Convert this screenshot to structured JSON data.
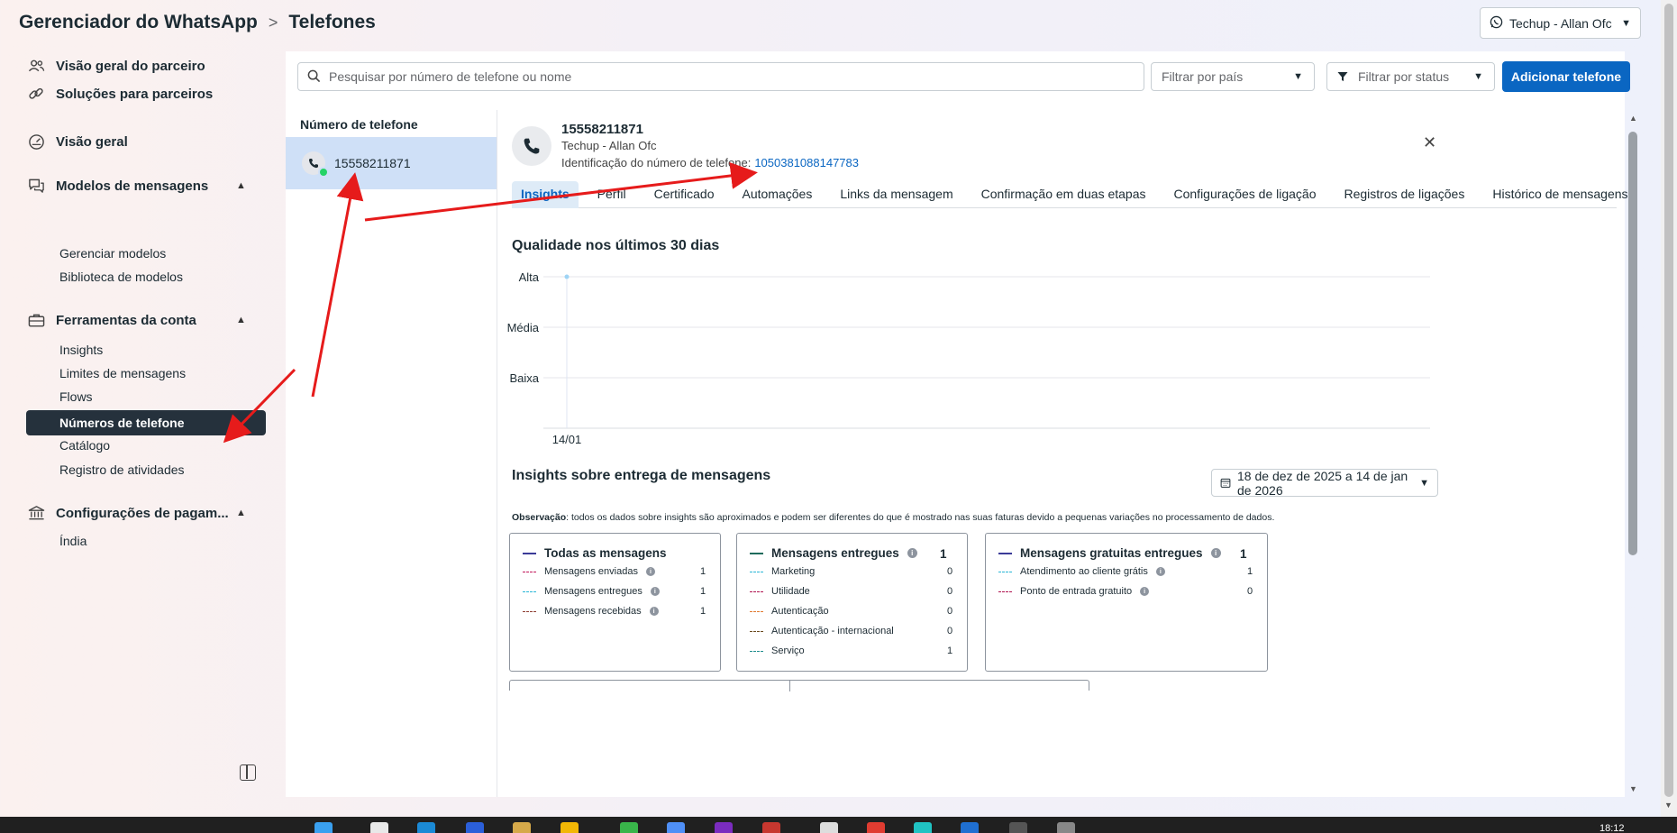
{
  "header": {
    "app_title": "Gerenciador do WhatsApp",
    "separator": ">",
    "page_title": "Telefones",
    "account_label": "Techup - Allan Ofc"
  },
  "sidebar": {
    "partner_overview": "Visão geral do parceiro",
    "partner_solutions": "Soluções para parceiros",
    "overview": "Visão geral",
    "message_templates": {
      "label": "Modelos de mensagens",
      "items": [
        "Gerenciar modelos",
        "Biblioteca de modelos"
      ]
    },
    "account_tools": {
      "label": "Ferramentas da conta",
      "items": [
        "Insights",
        "Limites de mensagens",
        "Flows",
        "Números de telefone",
        "Catálogo",
        "Registro de atividades"
      ],
      "active": "Números de telefone"
    },
    "payment_settings": {
      "label": "Configurações de pagam...",
      "items": [
        "Índia"
      ]
    }
  },
  "toolbar": {
    "search_placeholder": "Pesquisar por número de telefone ou nome",
    "filter_country": "Filtrar por país",
    "filter_status": "Filtrar por status",
    "add_button": "Adicionar telefone"
  },
  "phone_list": {
    "header": "Número de telefone",
    "items": [
      "15558211871"
    ]
  },
  "detail": {
    "number": "15558211871",
    "name": "Techup - Allan Ofc",
    "id_label": "Identificação do número de telefone:",
    "id_value": "1050381088147783",
    "tabs": [
      "Insights",
      "Perfil",
      "Certificado",
      "Automações",
      "Links da mensagem",
      "Confirmação em duas etapas",
      "Configurações de ligação",
      "Registros de ligações",
      "Histórico de mensagens"
    ],
    "active_tab": "Insights",
    "quality_title": "Qualidade nos últimos 30 dias",
    "delivery_title": "Insights sobre entrega de mensagens",
    "date_range": "18 de dez de 2025 a 14 de jan de 2026",
    "note_bold": "Observação",
    "note_text": ": todos os dados sobre insights são aproximados e podem ser diferentes do que é mostrado nas suas faturas devido a pequenas variações no processamento de dados."
  },
  "chart_data": {
    "type": "line",
    "title": "Qualidade nos últimos 30 dias",
    "y_categories": [
      "Baixa",
      "Média",
      "Alta"
    ],
    "x": [
      "14/01"
    ],
    "series": [
      {
        "values": [
          "Alta"
        ]
      }
    ],
    "grid": true
  },
  "cards": [
    {
      "title": "Todas as mensagens",
      "total": "",
      "line_color": "#3b3b98",
      "rows": [
        {
          "label": "Mensagens enviadas",
          "value": "1",
          "color": "#c2185b",
          "info": true
        },
        {
          "label": "Mensagens entregues",
          "value": "1",
          "color": "#29b6d6",
          "info": true
        },
        {
          "label": "Mensagens recebidas",
          "value": "1",
          "color": "#8d3b2f",
          "info": true
        }
      ]
    },
    {
      "title": "Mensagens entregues",
      "total": "1",
      "line_color": "#1e6b5c",
      "rows": [
        {
          "label": "Marketing",
          "value": "0",
          "color": "#29b6d6",
          "info": false
        },
        {
          "label": "Utilidade",
          "value": "0",
          "color": "#b0124f",
          "info": false
        },
        {
          "label": "Autenticação",
          "value": "0",
          "color": "#e0782f",
          "info": false
        },
        {
          "label": "Autenticação - internacional",
          "value": "0",
          "color": "#6b4a1f",
          "info": false
        },
        {
          "label": "Serviço",
          "value": "1",
          "color": "#1e8c8c",
          "info": false
        }
      ]
    },
    {
      "title": "Mensagens gratuitas entregues",
      "total": "1",
      "line_color": "#3b3b98",
      "rows": [
        {
          "label": "Atendimento ao cliente grátis",
          "value": "1",
          "color": "#29b6d6",
          "info": true
        },
        {
          "label": "Ponto de entrada gratuito",
          "value": "0",
          "color": "#b0124f",
          "info": true
        }
      ]
    }
  ],
  "taskbar": {
    "clock": "18:12"
  },
  "colors": {
    "primary": "#0a66c2",
    "active_nav": "#25313c",
    "selected_row": "#cfe0f7",
    "annotation": "#e61b1b"
  }
}
